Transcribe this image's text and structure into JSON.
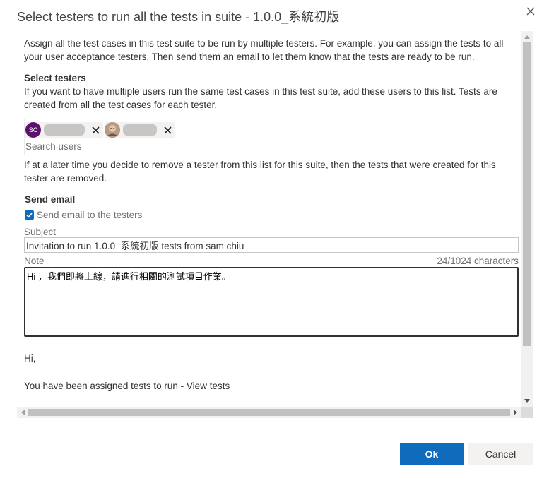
{
  "dialog": {
    "title": "Select testers to run all the tests in suite - 1.0.0_系統初版",
    "close_icon": "close-icon"
  },
  "intro": "Assign all the test cases in this test suite to be run by multiple testers. For example, you can assign the tests to all your user acceptance testers. Then send them an email to let them know that the tests are ready to be run.",
  "select_testers": {
    "heading": "Select testers",
    "description": "If you want to have multiple users run the same test cases in this test suite, add these users to this list. Tests are created from all the test cases for each tester.",
    "selected": [
      {
        "initials": "SC",
        "avatar_color": "#5c126b",
        "remove_icon": "close-icon"
      },
      {
        "initials": "",
        "avatar_color": "#8a6a55",
        "remove_icon": "close-icon"
      }
    ],
    "search_placeholder": "Search users",
    "remove_note": "If at a later time you decide to remove a tester from this list for this suite, then the tests that were created for this tester are removed."
  },
  "send_email": {
    "heading": "Send email",
    "checkbox_label": "Send email to the testers",
    "checked": true,
    "subject_label": "Subject",
    "subject_value": "Invitation to run 1.0.0_系統初版 tests from sam chiu",
    "note_label": "Note",
    "note_count": "24/1024 characters",
    "note_value": "Hi ，我們即將上線，請進行相關的測試項目作業。"
  },
  "preview": {
    "greeting": "Hi,",
    "assigned_text": "You have been assigned tests to run - ",
    "link_label": "View tests"
  },
  "buttons": {
    "ok": "Ok",
    "cancel": "Cancel"
  },
  "colors": {
    "accent": "#0f6cbd"
  }
}
